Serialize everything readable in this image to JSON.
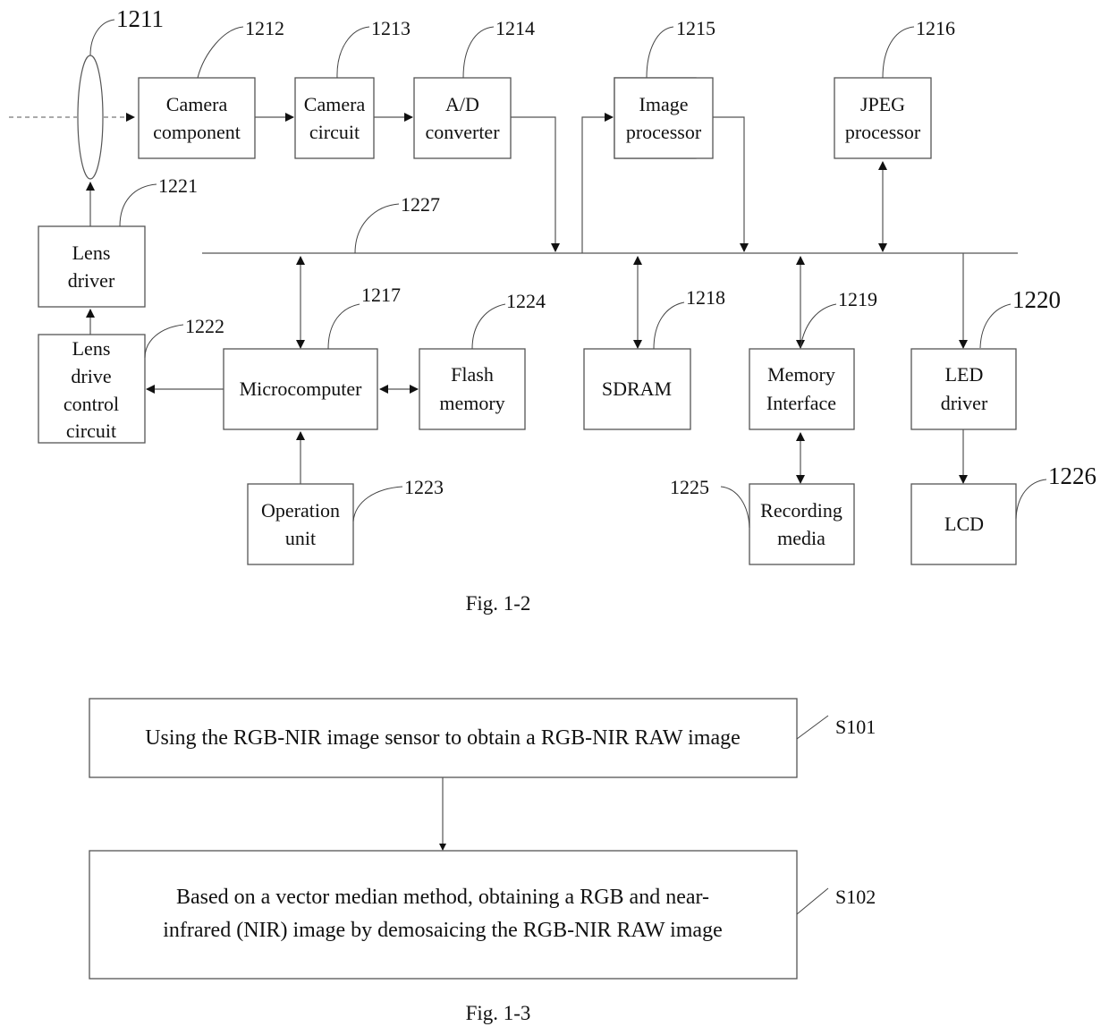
{
  "fig12": {
    "caption": "Fig. 1-2",
    "blocks": {
      "camera_component": {
        "lines": [
          "Camera",
          "component"
        ],
        "ref": "1212"
      },
      "camera_circuit": {
        "lines": [
          "Camera",
          "circuit"
        ],
        "ref": "1213"
      },
      "ad_converter": {
        "lines": [
          "A/D",
          "converter"
        ],
        "ref": "1214"
      },
      "image_processor": {
        "lines": [
          "Image",
          "processor"
        ],
        "ref": "1215"
      },
      "jpeg_processor": {
        "lines": [
          "JPEG",
          "processor"
        ],
        "ref": "1216"
      },
      "microcomputer": {
        "lines": [
          "Microcomputer"
        ],
        "ref": "1217"
      },
      "sdram": {
        "lines": [
          "SDRAM"
        ],
        "ref": "1218"
      },
      "memory_interface": {
        "lines": [
          "Memory",
          "Interface"
        ],
        "ref": "1219"
      },
      "led_driver": {
        "lines": [
          "LED",
          "driver"
        ],
        "ref": "1220"
      },
      "lens_driver": {
        "lines": [
          "Lens",
          "driver"
        ],
        "ref": "1221"
      },
      "lens_drive_control": {
        "lines": [
          "Lens",
          "drive",
          "control",
          "circuit"
        ],
        "ref": "1222"
      },
      "operation_unit": {
        "lines": [
          "Operation",
          "unit"
        ],
        "ref": "1223"
      },
      "flash_memory": {
        "lines": [
          "Flash",
          "memory"
        ],
        "ref": "1224"
      },
      "recording_media": {
        "lines": [
          "Recording",
          "media"
        ],
        "ref": "1225"
      },
      "lcd": {
        "lines": [
          "LCD"
        ],
        "ref": "1226"
      }
    },
    "lens_ref": "1211",
    "bus_ref": "1227"
  },
  "fig13": {
    "caption": "Fig. 1-3",
    "steps": [
      {
        "id": "S101",
        "lines": [
          "Using the RGB-NIR image sensor to obtain a RGB-NIR RAW image"
        ]
      },
      {
        "id": "S102",
        "lines": [
          "Based on a vector median method, obtaining a RGB and near-",
          "infrared (NIR) image by demosaicing the RGB-NIR RAW image"
        ]
      }
    ]
  }
}
